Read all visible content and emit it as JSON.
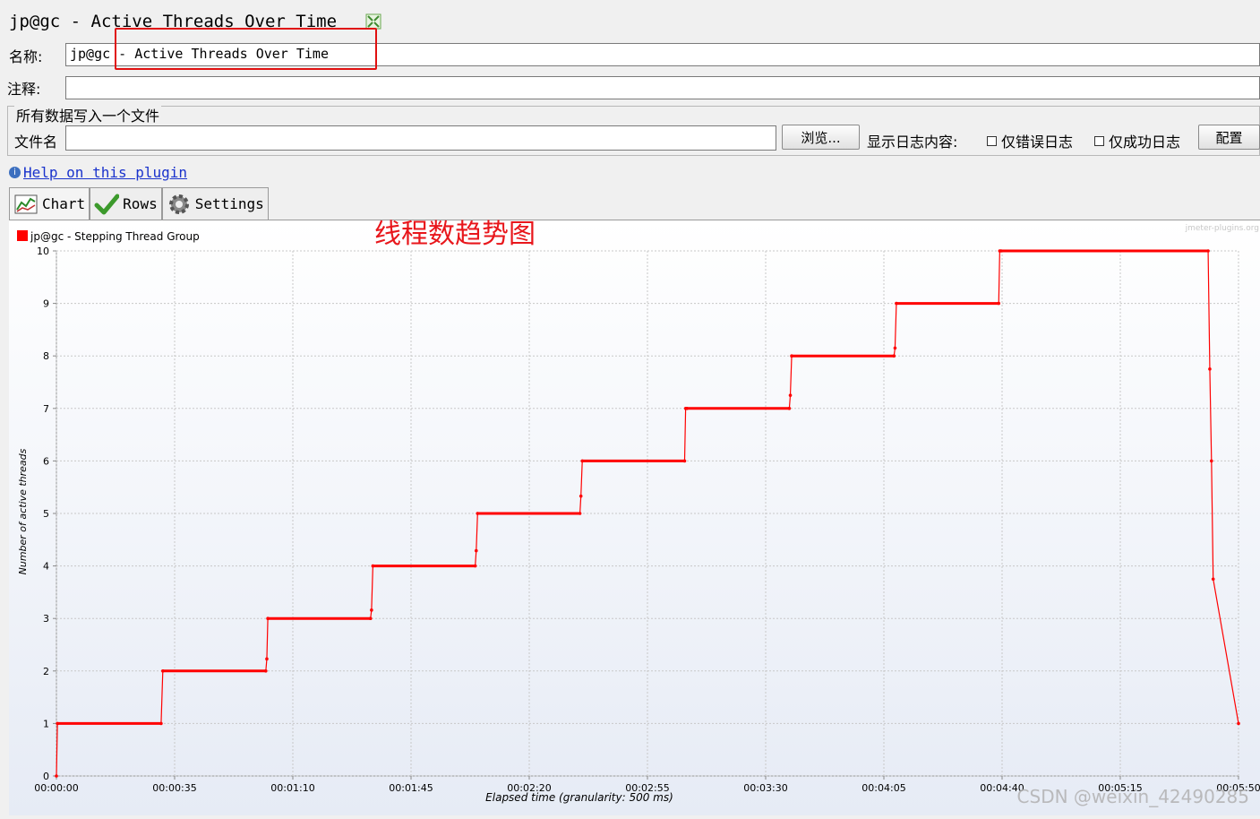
{
  "window": {
    "title": "jp@gc - Active Threads Over Time"
  },
  "form": {
    "name_label": "名称:",
    "name_value": "jp@gc - Active Threads Over Time",
    "comment_label": "注释:",
    "comment_value": ""
  },
  "file_section": {
    "legend": "所有数据写入一个文件",
    "filename_label": "文件名",
    "filename_value": "",
    "browse_button": "浏览...",
    "log_display_label": "显示日志内容:",
    "errors_only_label": "仅错误日志",
    "success_only_label": "仅成功日志",
    "configure_button": "配置"
  },
  "help": {
    "icon": "info-icon",
    "link": "Help on this plugin"
  },
  "tabs": [
    {
      "label": "Chart",
      "icon": "chart-icon",
      "active": true
    },
    {
      "label": "Rows",
      "icon": "checkmark-icon",
      "active": false
    },
    {
      "label": "Settings",
      "icon": "gear-icon",
      "active": false
    }
  ],
  "annotation": {
    "text": "线程数趋势图",
    "color": "#e8161b"
  },
  "watermark": "jmeter-plugins.org",
  "csdn_watermark": "CSDN @weixin_42490285",
  "chart_data": {
    "type": "line",
    "xlabel": "Elapsed time (granularity: 500 ms)",
    "ylabel": "Number of active threads",
    "xlim": [
      0,
      350
    ],
    "ylim": [
      0,
      10
    ],
    "x_ticks": [
      0,
      35,
      70,
      105,
      140,
      175,
      210,
      245,
      280,
      315,
      350
    ],
    "x_tick_labels": [
      "00:00:00",
      "00:00:35",
      "00:01:10",
      "00:01:45",
      "00:02:20",
      "00:02:55",
      "00:03:30",
      "00:04:05",
      "00:04:40",
      "00:05:15",
      "00:05:50"
    ],
    "y_ticks": [
      0,
      1,
      2,
      3,
      4,
      5,
      6,
      7,
      8,
      9,
      10
    ],
    "grid": true,
    "legend_position": "top-left",
    "series": [
      {
        "name": "jp@gc - Stepping Thread Group",
        "color": "#ff0000",
        "x": [
          0,
          0.3,
          31,
          31.5,
          62,
          62.3,
          62.6,
          93,
          93.3,
          93.7,
          124,
          124.3,
          124.7,
          155,
          155.3,
          155.7,
          186,
          186.3,
          186.7,
          217,
          217.3,
          217.7,
          248,
          248.3,
          248.7,
          279,
          279.3,
          279.7,
          341,
          341.5,
          342,
          342.5,
          350
        ],
        "y": [
          0,
          1,
          1,
          2,
          2,
          2.23,
          3,
          3,
          3.16,
          4,
          4,
          4.29,
          5,
          5,
          5.33,
          6,
          6,
          7,
          7,
          7,
          7.25,
          8,
          8,
          8.15,
          9,
          9,
          10,
          10,
          10,
          7.75,
          6,
          3.75,
          1
        ]
      }
    ]
  }
}
